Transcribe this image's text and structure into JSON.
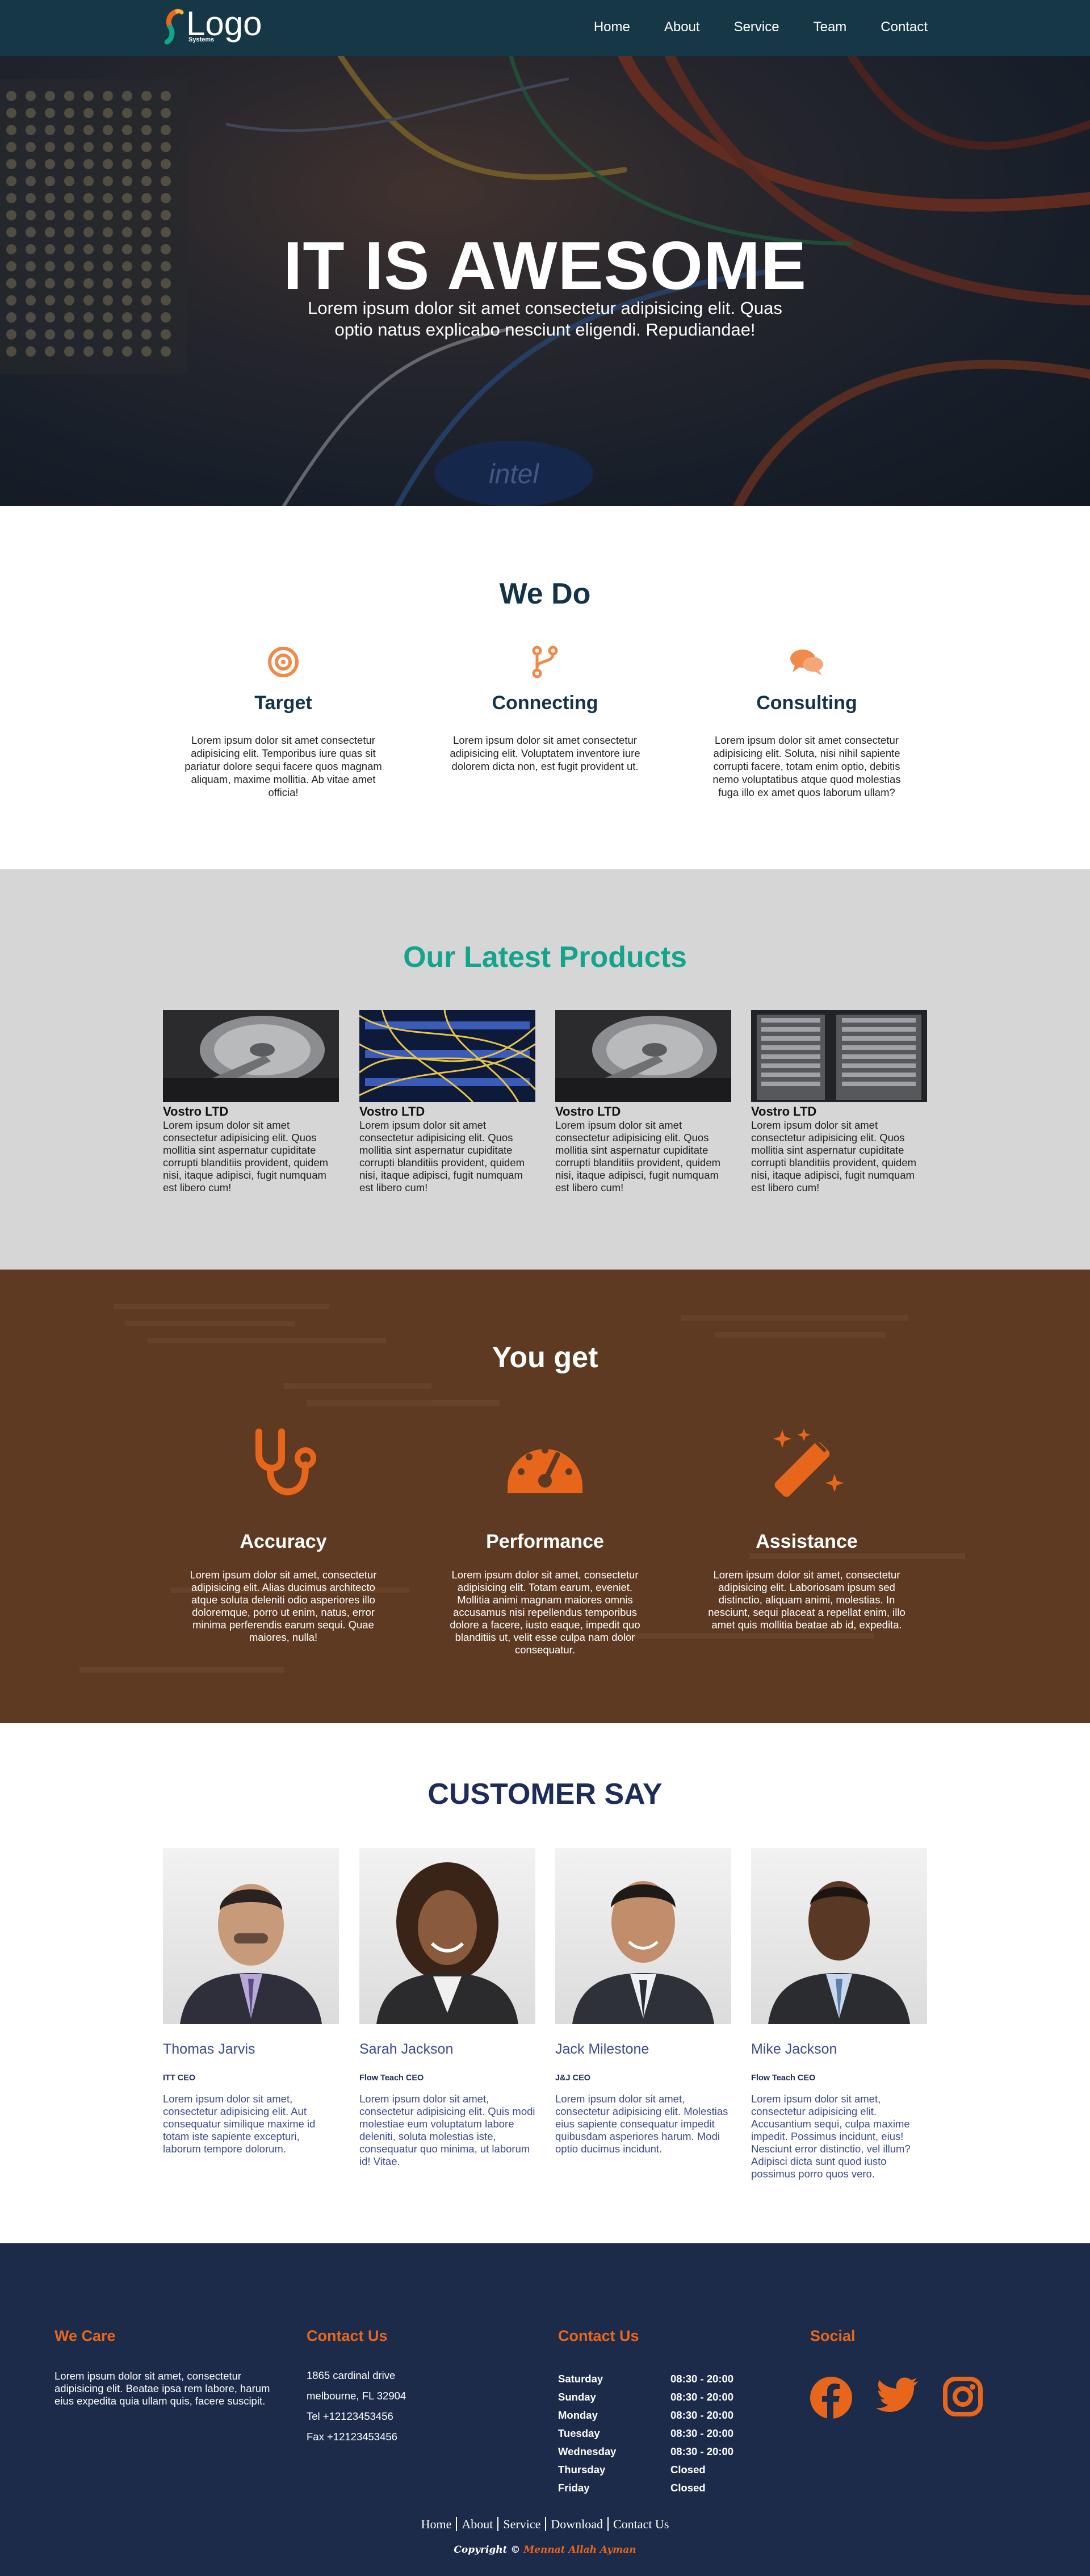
{
  "brand": {
    "logo_text": "Logo",
    "logo_sub": "Systems"
  },
  "nav": {
    "items": [
      "Home",
      "About",
      "Service",
      "Team",
      "Contact"
    ]
  },
  "hero": {
    "title": "IT IS AWESOME",
    "subtitle": "Lorem ipsum dolor sit amet consectetur adipisicing elit. Quas optio natus explicabo nesciunt eligendi. Repudiandae!",
    "chip_text": "intel"
  },
  "we_do": {
    "title": "We Do",
    "items": [
      {
        "icon": "target-icon",
        "title": "Target",
        "text": "Lorem ipsum dolor sit amet consectetur adipisicing elit. Temporibus iure quas sit pariatur dolore sequi facere quos magnam aliquam, maxime mollitia. Ab vitae amet officia!"
      },
      {
        "icon": "branch-icon",
        "title": "Connecting",
        "text": "Lorem ipsum dolor sit amet consectetur adipisicing elit. Voluptatem inventore iure dolorem dicta non, est fugit provident ut."
      },
      {
        "icon": "chat-icon",
        "title": "Consulting",
        "text": "Lorem ipsum dolor sit amet consectetur adipisicing elit. Soluta, nisi nihil sapiente corrupti facere, totam enim optio, debitis nemo voluptatibus atque quod molestias fuga illo ex amet quos laborum ullam?"
      }
    ]
  },
  "products": {
    "title": "Our Latest Products",
    "items": [
      {
        "image": "hard-drive",
        "name": "Vostro LTD",
        "text": "Lorem ipsum dolor sit amet consectetur adipisicing elit. Quos mollitia sint aspernatur cupiditate corrupti blanditiis provident, quidem nisi, itaque adipisci, fugit numquam est libero cum!"
      },
      {
        "image": "fiber-cables",
        "name": "Vostro LTD",
        "text": "Lorem ipsum dolor sit amet consectetur adipisicing elit. Quos mollitia sint aspernatur cupiditate corrupti blanditiis provident, quidem nisi, itaque adipisci, fugit numquam est libero cum!"
      },
      {
        "image": "hard-drive",
        "name": "Vostro LTD",
        "text": "Lorem ipsum dolor sit amet consectetur adipisicing elit. Quos mollitia sint aspernatur cupiditate corrupti blanditiis provident, quidem nisi, itaque adipisci, fugit numquam est libero cum!"
      },
      {
        "image": "server-rack",
        "name": "Vostro LTD",
        "text": "Lorem ipsum dolor sit amet consectetur adipisicing elit. Quos mollitia sint aspernatur cupiditate corrupti blanditiis provident, quidem nisi, itaque adipisci, fugit numquam est libero cum!"
      }
    ]
  },
  "you_get": {
    "title": "You get",
    "items": [
      {
        "icon": "stethoscope-icon",
        "title": "Accuracy",
        "text": "Lorem ipsum dolor sit amet, consectetur adipisicing elit. Alias ducimus architecto atque soluta deleniti odio asperiores illo doloremque, porro ut enim, natus, error minima perferendis earum sequi. Quae maiores, nulla!"
      },
      {
        "icon": "gauge-icon",
        "title": "Performance",
        "text": "Lorem ipsum dolor sit amet, consectetur adipisicing elit. Totam earum, eveniet. Mollitia animi magnam maiores omnis accusamus nisi repellendus temporibus dolore a facere, iusto eaque, impedit quo blanditiis ut, velit esse culpa nam dolor consequatur."
      },
      {
        "icon": "magic-wand-icon",
        "title": "Assistance",
        "text": "Lorem ipsum dolor sit amet, consectetur adipisicing elit. Laboriosam ipsum sed distinctio, aliquam animi, molestias. In nesciunt, sequi placeat a repellat enim, illo amet quis mollitia beatae ab id, expedita."
      }
    ]
  },
  "customers": {
    "title": "CUSTOMER SAY",
    "items": [
      {
        "name": "Thomas Jarvis",
        "role": "ITT CEO",
        "text": "Lorem ipsum dolor sit amet, consectetur adipisicing elit. Aut consequatur similique maxime id totam iste sapiente excepturi, laborum tempore dolorum."
      },
      {
        "name": "Sarah Jackson",
        "role": "Flow Teach CEO",
        "text": "Lorem ipsum dolor sit amet, consectetur adipisicing elit. Quis modi molestiae eum voluptatum labore deleniti, soluta molestias iste, consequatur quo minima, ut laborum id! Vitae."
      },
      {
        "name": "Jack Milestone",
        "role": "J&J CEO",
        "text": "Lorem ipsum dolor sit amet, consectetur adipisicing elit. Molestias eius sapiente consequatur impedit quibusdam asperiores harum. Modi optio ducimus incidunt."
      },
      {
        "name": "Mike Jackson",
        "role": "Flow Teach CEO",
        "text": "Lorem ipsum dolor sit amet, consectetur adipisicing elit. Accusantium sequi, culpa maxime impedit. Possimus incidunt, eius! Nesciunt error distinctio, vel illum? Adipisci dicta sunt quod iusto possimus porro quos vero."
      }
    ]
  },
  "footer": {
    "we_care": {
      "title": "We Care",
      "text": "Lorem ipsum dolor sit amet, consectetur adipisicing elit. Beatae ipsa rem labore, harum eius expedita quia ullam quis, facere suscipit."
    },
    "contact": {
      "title": "Contact Us",
      "lines": [
        "1865 cardinal drive",
        "melbourne, FL 32904",
        "Tel +12123453456",
        "Fax +12123453456"
      ]
    },
    "hours": {
      "title": "Contact Us",
      "rows": [
        {
          "day": "Saturday",
          "time": "08:30 - 20:00"
        },
        {
          "day": "Sunday",
          "time": "08:30 - 20:00"
        },
        {
          "day": "Monday",
          "time": "08:30 - 20:00"
        },
        {
          "day": "Tuesday",
          "time": "08:30 - 20:00"
        },
        {
          "day": "Wednesday",
          "time": "08:30 - 20:00"
        },
        {
          "day": "Thursday",
          "time": "Closed"
        },
        {
          "day": "Friday",
          "time": "Closed"
        }
      ]
    },
    "social": {
      "title": "Social",
      "icons": [
        "facebook-icon",
        "twitter-icon",
        "instagram-icon"
      ]
    },
    "links": [
      "Home",
      "About",
      "Service",
      "Download",
      "Contact Us"
    ],
    "copyright_prefix": "Copyright ©",
    "copyright_name": "Mennat Allah Ayman"
  },
  "colors": {
    "accent": "#e8661c",
    "navy": "#133448",
    "teal": "#14a48c",
    "footer_bg": "#1d2b4b",
    "brown": "#5e3a22"
  }
}
